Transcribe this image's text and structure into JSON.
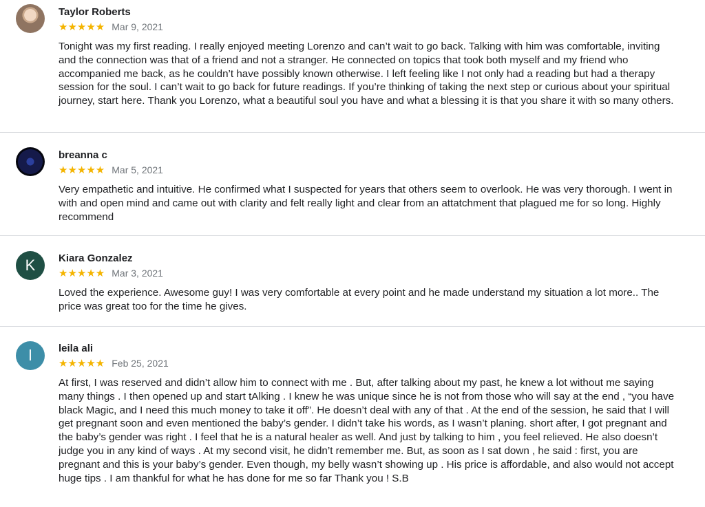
{
  "reviews": [
    {
      "name": "Taylor Roberts",
      "avatar_icon": "user-photo-avatar",
      "stars": "★★★★★",
      "date": "Mar 9, 2021",
      "text": "Tonight was my first reading. I really enjoyed meeting Lorenzo and can’t wait to go back. Talking with him was comfortable, inviting and the connection was that of a friend and not a stranger. He connected on topics that took both myself and my friend who accompanied me back, as he couldn’t have possibly known otherwise. I left feeling like I not only had a reading but had a therapy session for the soul. I can’t wait to go back for future readings. If you’re thinking of taking the next step or curious about your spiritual journey, start here. Thank you Lorenzo, what a beautiful soul you have and what a blessing it is that you share it with so many others."
    },
    {
      "name": "breanna c",
      "avatar_icon": "user-photo-avatar",
      "stars": "★★★★★",
      "date": "Mar 5, 2021",
      "text": "Very empathetic and intuitive. He confirmed what I suspected for years that others seem to overlook. He was very thorough. I went in with and open mind and came out with clarity and felt really light and clear from an attatchment that plagued me for so long. Highly recommend"
    },
    {
      "name": "Kiara Gonzalez",
      "avatar_letter": "K",
      "stars": "★★★★★",
      "date": "Mar 3, 2021",
      "text": "Loved the experience. Awesome guy! I was very comfortable at every point and he made understand my situation a lot more.. The price was great too for the time he gives."
    },
    {
      "name": "leila ali",
      "avatar_letter": "l",
      "stars": "★★★★★",
      "date": "Feb 25, 2021",
      "text": "At first, I was reserved and didn’t allow him to connect with me . But, after talking about my past, he knew a lot without me saying many things . I then opened up and start tAlking . I knew he was unique since he is not from those who will say at the end , “you have black Magic, and I need this much money to take it off”. He doesn’t deal with any of that . At the end of the session, he said that I will get pregnant soon and even mentioned the baby’s gender. I didn’t take his words, as I wasn’t planing. short after, I got pregnant and the baby’s gender was right . I feel that he is a natural healer as well. And just by talking to him , you feel relieved. He also doesn’t judge you in any kind of ways . At my second visit, he didn’t remember me. But, as soon as I sat down , he said : first, you are pregnant and this is your baby’s gender. Even though, my belly wasn’t showing up . His price is affordable, and also would not accept huge tips . I am thankful for what he has done for me so far Thank you ! S.B"
    }
  ],
  "colors": {
    "star": "#f4b400",
    "date": "#70757a",
    "divider": "#dadce0",
    "avatar_k": "#1f4f44",
    "avatar_l": "#3d8ea8"
  }
}
